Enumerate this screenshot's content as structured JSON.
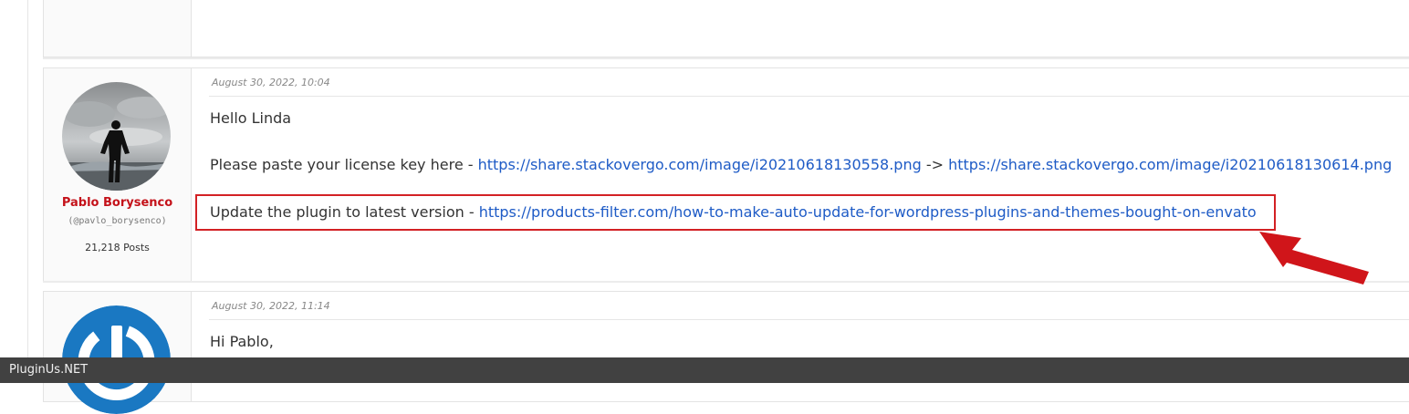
{
  "posts": [
    {
      "date": "August 30, 2022, 10:04",
      "author": {
        "name": "Pablo Borysenco",
        "handle": "(@pavlo_borysenco)",
        "posts": "21,218 Posts"
      },
      "greeting": "Hello Linda",
      "license_prefix": "Please paste your license key here - ",
      "license_link1": "https://share.stackovergo.com/image/i20210618130558.png",
      "license_sep": " -> ",
      "license_link2": "https://share.stackovergo.com/image/i20210618130614.png",
      "update_prefix": "Update  the  plugin  to latest  version - ",
      "update_link": "https://products-filter.com/how-to-make-auto-update-for-wordpress-plugins-and-themes-bought-on-envato"
    },
    {
      "date": "August 30, 2022, 11:14",
      "greeting": "Hi Pablo,"
    }
  ],
  "status_bar": {
    "text": "PluginUs.NET"
  },
  "colors": {
    "author_name": "#c4121a",
    "link": "#1e5bc6",
    "highlight": "#d32124",
    "status_bar_bg": "#414141"
  }
}
